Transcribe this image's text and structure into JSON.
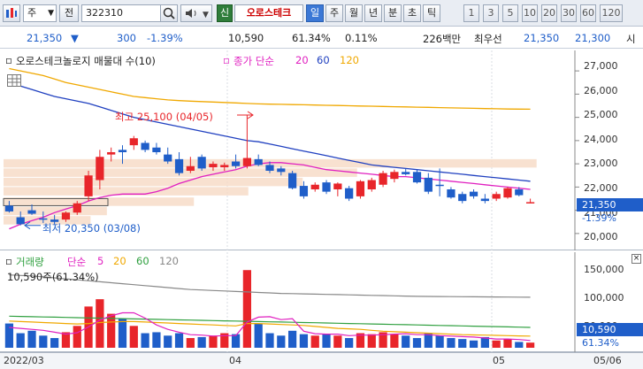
{
  "toolbar": {
    "market": "주",
    "prev": "전",
    "code": "322310",
    "new_label": "신",
    "stock_name": "오로스테크",
    "periods": [
      "일",
      "주",
      "월",
      "년",
      "분",
      "초",
      "틱"
    ],
    "active_period": "일",
    "minute_options": [
      "1",
      "3",
      "5",
      "10",
      "20",
      "30",
      "60",
      "120"
    ]
  },
  "quote": {
    "price": "21,350",
    "direction": "▼",
    "change": "300",
    "change_pct": "-1.39%",
    "volume": "10,590",
    "volume_ratio": "61.34%",
    "turnover": "0.11%",
    "amount": "226백만",
    "best_label": "최우선",
    "ask": "21,350",
    "bid": "21,300",
    "market_label": "시"
  },
  "price_pane": {
    "title": "오로스테크놀로지 매물대 수(10)",
    "ma_label": "종가 단순",
    "ma_periods": [
      "20",
      "60",
      "120"
    ],
    "ma_colors": [
      "#e020c0",
      "#2040c0",
      "#f0a800"
    ],
    "axis_ticks": [
      "27,000",
      "26,000",
      "25,000",
      "24,000",
      "23,000",
      "22,000",
      "21,000",
      "20,000"
    ],
    "current_price_label": "21,350",
    "current_change_label": "-1.39%",
    "high_note": "최고 25,100 (04/05)",
    "low_note": "최저 20,350 (03/08)"
  },
  "volume_pane": {
    "title": "거래량",
    "ma_label": "단순",
    "ma_periods": [
      "5",
      "20",
      "60",
      "120"
    ],
    "ma_colors": [
      "#e020c0",
      "#f0a800",
      "#30a040",
      "#888888"
    ],
    "subtitle": "10,590주(61.34%)",
    "axis_ticks": [
      "150,000",
      "100,000",
      "50,000"
    ],
    "current_label": "10,590",
    "current_pct": "61.34%"
  },
  "dates": {
    "labels": [
      "2022/03",
      "04",
      "05"
    ],
    "last": "05/06"
  },
  "chart_data": {
    "type": "candlestick",
    "ylim": [
      19500,
      27500
    ],
    "colors": {
      "up": "#e8252a",
      "down": "#1f5ec9"
    },
    "candles": [
      {
        "o": 21200,
        "h": 21400,
        "l": 20900,
        "c": 20950
      },
      {
        "o": 20700,
        "h": 20950,
        "l": 20350,
        "c": 20400
      },
      {
        "o": 21000,
        "h": 21250,
        "l": 20800,
        "c": 20850
      },
      {
        "o": 20650,
        "h": 20950,
        "l": 20450,
        "c": 20600
      },
      {
        "o": 20600,
        "h": 20800,
        "l": 20400,
        "c": 20500
      },
      {
        "o": 20600,
        "h": 20950,
        "l": 20500,
        "c": 20900
      },
      {
        "o": 20900,
        "h": 21400,
        "l": 20800,
        "c": 21300
      },
      {
        "o": 21600,
        "h": 22700,
        "l": 21400,
        "c": 22500
      },
      {
        "o": 22300,
        "h": 23600,
        "l": 21900,
        "c": 23300
      },
      {
        "o": 23400,
        "h": 23700,
        "l": 23100,
        "c": 23500
      },
      {
        "o": 23600,
        "h": 23800,
        "l": 23000,
        "c": 23500
      },
      {
        "o": 23800,
        "h": 24200,
        "l": 23600,
        "c": 24100
      },
      {
        "o": 23900,
        "h": 24000,
        "l": 23500,
        "c": 23600
      },
      {
        "o": 23700,
        "h": 23900,
        "l": 23400,
        "c": 23500
      },
      {
        "o": 23400,
        "h": 23700,
        "l": 23000,
        "c": 23100
      },
      {
        "o": 23200,
        "h": 23500,
        "l": 22500,
        "c": 22600
      },
      {
        "o": 22700,
        "h": 23300,
        "l": 22600,
        "c": 22900
      },
      {
        "o": 23300,
        "h": 23400,
        "l": 22700,
        "c": 22800
      },
      {
        "o": 22850,
        "h": 23100,
        "l": 22700,
        "c": 23000
      },
      {
        "o": 22850,
        "h": 23050,
        "l": 22700,
        "c": 22950
      },
      {
        "o": 23100,
        "h": 23400,
        "l": 22800,
        "c": 22900
      },
      {
        "o": 22900,
        "h": 25100,
        "l": 22800,
        "c": 23250
      },
      {
        "o": 23200,
        "h": 23400,
        "l": 22900,
        "c": 22950
      },
      {
        "o": 22950,
        "h": 23100,
        "l": 22600,
        "c": 22700
      },
      {
        "o": 22800,
        "h": 22900,
        "l": 22500,
        "c": 22650
      },
      {
        "o": 22600,
        "h": 22700,
        "l": 21900,
        "c": 21950
      },
      {
        "o": 22050,
        "h": 22250,
        "l": 21500,
        "c": 21600
      },
      {
        "o": 21900,
        "h": 22200,
        "l": 21800,
        "c": 22100
      },
      {
        "o": 22200,
        "h": 22300,
        "l": 21700,
        "c": 21800
      },
      {
        "o": 21900,
        "h": 22200,
        "l": 21600,
        "c": 22150
      },
      {
        "o": 21950,
        "h": 22050,
        "l": 21400,
        "c": 21500
      },
      {
        "o": 21600,
        "h": 22300,
        "l": 21500,
        "c": 22250
      },
      {
        "o": 21900,
        "h": 22400,
        "l": 21800,
        "c": 22300
      },
      {
        "o": 22100,
        "h": 22700,
        "l": 22000,
        "c": 22600
      },
      {
        "o": 22350,
        "h": 22750,
        "l": 22200,
        "c": 22650
      },
      {
        "o": 22650,
        "h": 22800,
        "l": 22500,
        "c": 22550
      },
      {
        "o": 22650,
        "h": 22750,
        "l": 22150,
        "c": 22200
      },
      {
        "o": 22400,
        "h": 22600,
        "l": 21700,
        "c": 21800
      },
      {
        "o": 22100,
        "h": 22800,
        "l": 21600,
        "c": 22050
      },
      {
        "o": 21900,
        "h": 22000,
        "l": 21500,
        "c": 21550
      },
      {
        "o": 21700,
        "h": 21800,
        "l": 21300,
        "c": 21400
      },
      {
        "o": 21800,
        "h": 21900,
        "l": 21500,
        "c": 21600
      },
      {
        "o": 21500,
        "h": 21700,
        "l": 21300,
        "c": 21400
      },
      {
        "o": 21500,
        "h": 21800,
        "l": 21400,
        "c": 21700
      },
      {
        "o": 21550,
        "h": 22000,
        "l": 21500,
        "c": 21950
      },
      {
        "o": 21900,
        "h": 22000,
        "l": 21600,
        "c": 21650
      },
      {
        "o": 21350,
        "h": 21500,
        "l": 21300,
        "c": 21350
      }
    ],
    "volumes": [
      50000,
      30000,
      35000,
      25000,
      20000,
      32000,
      45000,
      85000,
      100000,
      70000,
      60000,
      45000,
      30000,
      32000,
      25000,
      30000,
      20000,
      22000,
      25000,
      30000,
      28000,
      160000,
      50000,
      30000,
      25000,
      35000,
      28000,
      25000,
      28000,
      25000,
      20000,
      30000,
      28000,
      32000,
      28000,
      25000,
      20000,
      30000,
      25000,
      20000,
      18000,
      15000,
      22000,
      15000,
      18000,
      12000,
      10590
    ],
    "ma20": [
      20200,
      20400,
      20550,
      20700,
      20900,
      21050,
      21200,
      21400,
      21550,
      21650,
      21700,
      21700,
      21700,
      21800,
      21950,
      22150,
      22300,
      22450,
      22550,
      22650,
      22750,
      22900,
      23000,
      23050,
      23050,
      23000,
      22950,
      22850,
      22750,
      22700,
      22650,
      22600,
      22550,
      22500,
      22450,
      22450,
      22400,
      22350,
      22300,
      22250,
      22200,
      22150,
      22100,
      22050,
      22000,
      21950,
      21900
    ],
    "ma60": [
      26500,
      26350,
      26200,
      26050,
      25900,
      25800,
      25700,
      25600,
      25450,
      25300,
      25150,
      25000,
      24900,
      24800,
      24700,
      24600,
      24500,
      24400,
      24300,
      24200,
      24100,
      24000,
      23950,
      23850,
      23750,
      23650,
      23550,
      23450,
      23350,
      23250,
      23150,
      23050,
      22950,
      22900,
      22850,
      22800,
      22750,
      22700,
      22650,
      22600,
      22550,
      22500,
      22450,
      22400,
      22350,
      22300,
      22250
    ],
    "ma120": [
      27100,
      27000,
      26900,
      26800,
      26650,
      26500,
      26400,
      26300,
      26200,
      26100,
      26000,
      25900,
      25850,
      25800,
      25750,
      25720,
      25700,
      25680,
      25660,
      25640,
      25620,
      25600,
      25580,
      25570,
      25560,
      25550,
      25540,
      25530,
      25520,
      25510,
      25500,
      25490,
      25480,
      25470,
      25460,
      25450,
      25440,
      25430,
      25420,
      25410,
      25400,
      25390,
      25380,
      25370,
      25360,
      25355,
      25350
    ],
    "vol_ylim": [
      0,
      175000
    ],
    "vol_ma5": [
      42000,
      40000,
      38000,
      36000,
      32000,
      28000,
      31000,
      43000,
      57000,
      66000,
      72000,
      72000,
      61000,
      47000,
      38000,
      32000,
      27000,
      26000,
      24000,
      25000,
      25000,
      53000,
      63000,
      64000,
      58000,
      60000,
      34000,
      29000,
      28000,
      28000,
      25000,
      26000,
      26000,
      27000,
      28000,
      29000,
      27000,
      27000,
      25000,
      24000,
      23000,
      22000,
      20000,
      18000,
      18000,
      17000,
      15000
    ],
    "vol_ma20": [
      55000,
      54000,
      53000,
      52000,
      51000,
      50000,
      49000,
      50000,
      52000,
      53000,
      54000,
      54000,
      53000,
      52000,
      51000,
      50000,
      49000,
      48000,
      47000,
      46000,
      45000,
      50000,
      50000,
      49000,
      48000,
      47000,
      46000,
      44000,
      42000,
      40000,
      39000,
      38000,
      36000,
      34000,
      33000,
      32000,
      31000,
      30000,
      29000,
      28000,
      27000,
      26500,
      26000,
      25500,
      25000,
      24500,
      24000
    ],
    "vol_ma60": [
      65000,
      64500,
      64000,
      63500,
      63000,
      62500,
      62000,
      61500,
      61000,
      60500,
      60000,
      59500,
      59000,
      58500,
      58000,
      57500,
      57000,
      56500,
      56000,
      55500,
      55000,
      54500,
      54000,
      53500,
      53000,
      52500,
      52000,
      51500,
      51000,
      50500,
      50000,
      49500,
      49000,
      48500,
      48000,
      47500,
      47000,
      46500,
      46000,
      45500,
      45000,
      44500,
      44000,
      43500,
      43000,
      42500,
      42000
    ],
    "vol_ma120": [
      150000,
      149000,
      148000,
      146000,
      144000,
      142000,
      140000,
      138000,
      136000,
      134000,
      132000,
      130000,
      128000,
      126000,
      124000,
      122000,
      120000,
      119000,
      118000,
      117000,
      116000,
      115000,
      114000,
      113000,
      112000,
      111500,
      111000,
      110500,
      110000,
      109500,
      109000,
      108500,
      108000,
      107500,
      107000,
      106500,
      106000,
      105800,
      105600,
      105400,
      105200,
      105000,
      104800,
      104600,
      104400,
      104200,
      104000
    ],
    "volume_profile": [
      {
        "price": 23000,
        "weight": 0.98
      },
      {
        "price": 22600,
        "weight": 0.65
      },
      {
        "price": 22200,
        "weight": 0.55
      },
      {
        "price": 21800,
        "weight": 0.45
      },
      {
        "price": 21350,
        "weight": 0.35
      },
      {
        "price": 20950,
        "weight": 0.19
      },
      {
        "price": 20550,
        "weight": 0.16
      }
    ]
  }
}
